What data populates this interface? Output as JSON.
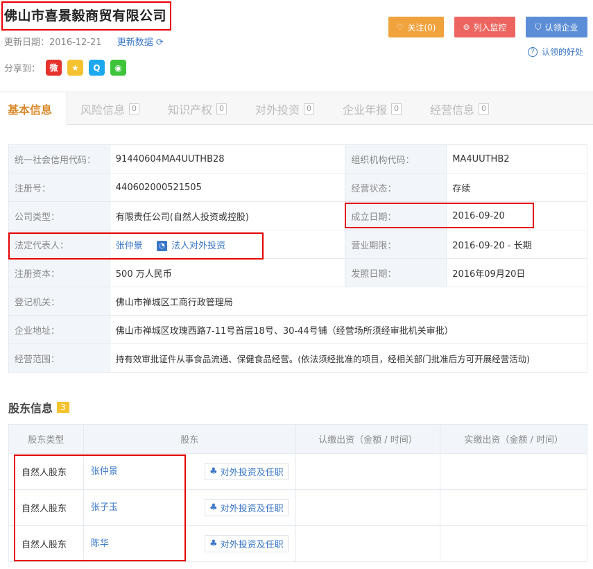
{
  "header": {
    "company_name": "佛山市喜景毅商贸有限公司",
    "update_label": "更新日期：",
    "update_date": "2016-12-21",
    "refresh_label": "更新数据",
    "share_label": "分享到：",
    "follow_label": "关注(0)",
    "monitor_label": "列入监控",
    "claim_label": "认领企业",
    "benefit_label": "认领的好处"
  },
  "tabs": [
    {
      "label": "基本信息",
      "count": ""
    },
    {
      "label": "风险信息",
      "count": "0"
    },
    {
      "label": "知识产权",
      "count": "0"
    },
    {
      "label": "对外投资",
      "count": "0"
    },
    {
      "label": "企业年报",
      "count": "0"
    },
    {
      "label": "经营信息",
      "count": "0"
    }
  ],
  "info": {
    "credit_code_label": "统一社会信用代码：",
    "credit_code": "91440604MA4UUTHB28",
    "org_code_label": "组织机构代码：",
    "org_code": "MA4UUTHB2",
    "reg_no_label": "注册号：",
    "reg_no": "440602000521505",
    "status_label": "经营状态：",
    "status": "存续",
    "company_type_label": "公司类型：",
    "company_type": "有限责任公司(自然人投资或控股)",
    "founded_label": "成立日期：",
    "founded": "2016-09-20",
    "legal_rep_label": "法定代表人：",
    "legal_rep": "张仲景",
    "legal_invest_label": "法人对外投资",
    "term_label": "营业期限：",
    "term": "2016-09-20 - 长期",
    "capital_label": "注册资本：",
    "capital": "500 万人民币",
    "issue_date_label": "发照日期：",
    "issue_date": "2016年09月20日",
    "authority_label": "登记机关：",
    "authority": "佛山市禅城区工商行政管理局",
    "address_label": "企业地址：",
    "address": "佛山市禅城区玫瑰西路7-11号首层18号、30-44号铺（经营场所须经审批机关审批）",
    "scope_label": "经营范围：",
    "scope": "持有效审批证件从事食品流通、保健食品经营。(依法须经批准的项目，经相关部门批准后方可开展经营活动)"
  },
  "shareholders": {
    "title": "股东信息",
    "count": "3",
    "headers": [
      "股东类型",
      "股东",
      "认缴出资（金额 / 时间）",
      "实缴出资（金额 / 时间）"
    ],
    "invest_btn": "对外投资及任职",
    "rows": [
      {
        "type": "自然人股东",
        "name": "张仲景"
      },
      {
        "type": "自然人股东",
        "name": "张子玉"
      },
      {
        "type": "自然人股东",
        "name": "陈华"
      }
    ]
  },
  "colors": {
    "follow": "#f0a23c",
    "monitor": "#ec6560",
    "claim": "#5c8ed8",
    "weibo": "#e6322c",
    "qzone": "#f5c230",
    "qq": "#1da8f0",
    "wechat": "#3ec43b",
    "highlight": "#e60000"
  }
}
